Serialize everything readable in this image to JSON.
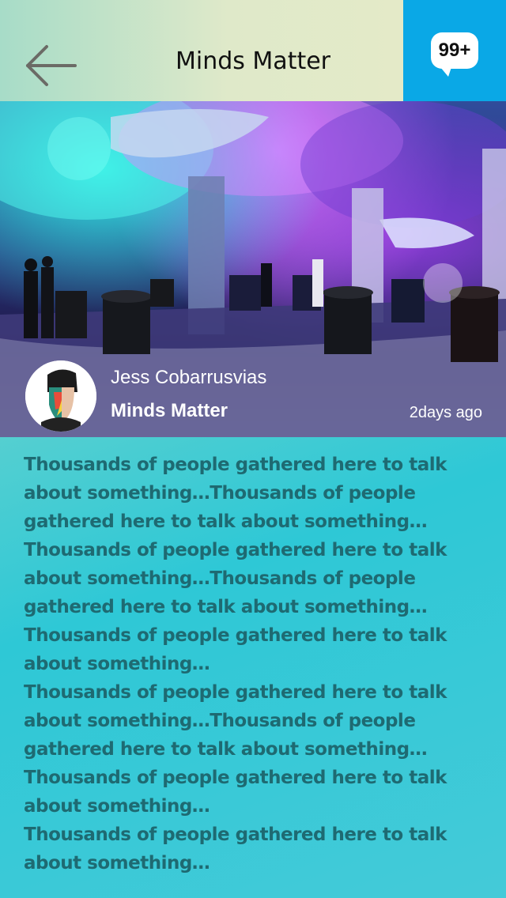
{
  "header": {
    "title": "Minds Matter",
    "back_icon": "arrow-left-icon",
    "notification_count": "99+",
    "notification_icon": "chat-bubble-icon",
    "accent_color": "#0aa8e6"
  },
  "post": {
    "image_description_icon": "event-photo",
    "author_name": "Jess Cobarrusvias",
    "channel": "Minds Matter",
    "time_ago": "2days ago",
    "paragraphs": [
      "Thousands of people gathered here to talk about something…Thousands of people gathered here to talk about something…Thousands of people gathered here to talk about something…Thousands of people gathered here to talk about something…Thousands of people gathered here to talk about something…",
      "Thousands of people gathered here to talk about something…Thousands of people gathered here to talk about something…Thousands of people gathered here to talk about something…",
      "Thousands of people gathered here to talk about something…"
    ]
  }
}
